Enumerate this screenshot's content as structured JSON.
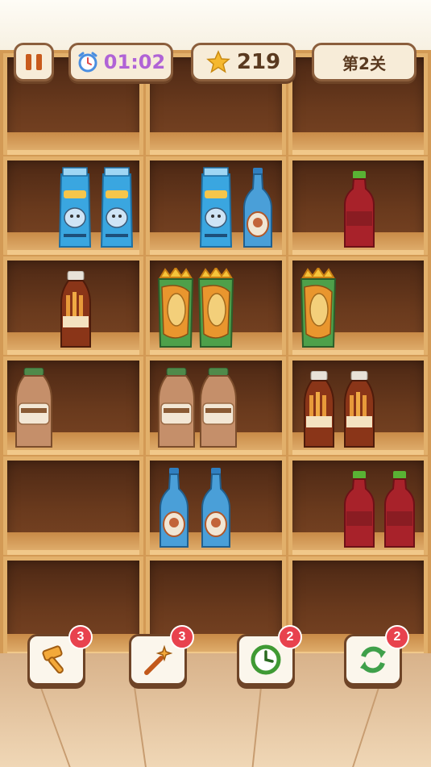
{
  "hud": {
    "pause_icon": "pause-icon",
    "timer_icon": "alarm-clock-icon",
    "timer": "01:02",
    "star_icon": "star-icon",
    "stars": "219",
    "level": "第2关"
  },
  "shelf": {
    "rows": [
      [
        "",
        "",
        ""
      ],
      [
        "milk-carton milk-carton",
        "milk-carton water-bottle",
        "cola-bottle"
      ],
      [
        "fries-bottle",
        "taco-cup taco-cup",
        "taco-cup"
      ],
      [
        "coffee-bottle",
        "coffee-bottle coffee-bottle",
        "fries-bottle fries-bottle"
      ],
      [
        "",
        "water-bottle water-bottle",
        "cola-bottle cola-bottle"
      ],
      [
        "",
        "",
        ""
      ]
    ]
  },
  "tools": [
    {
      "name": "hammer",
      "icon": "hammer-icon",
      "count": "3"
    },
    {
      "name": "magic-wand",
      "icon": "wand-icon",
      "count": "3"
    },
    {
      "name": "time",
      "icon": "clock-icon",
      "count": "2"
    },
    {
      "name": "shuffle",
      "icon": "refresh-icon",
      "count": "2"
    }
  ],
  "colors": {
    "shelf_wood": "#d39a55",
    "shelf_back": "#5a2f18",
    "timer_text": "#b063d6",
    "badge": "#e8424e"
  }
}
